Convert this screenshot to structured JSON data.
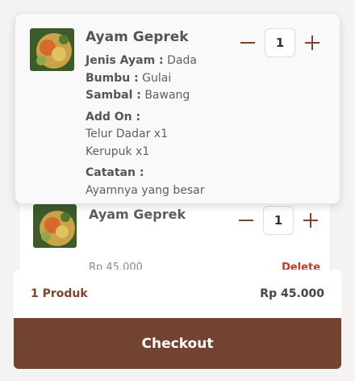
{
  "cart_item_front": {
    "name": "Ayam Geprek",
    "quantity": "1",
    "jenis_ayam_label": "Jenis Ayam :",
    "jenis_ayam_value": "Dada",
    "bumbu_label": "Bumbu :",
    "bumbu_value": "Gulai",
    "sambal_label": "Sambal :",
    "sambal_value": "Bawang",
    "addon_label": "Add On :",
    "addons": [
      "Telur Dadar x1",
      "Kerupuk x1"
    ],
    "catatan_label": "Catatan :",
    "catatan_value": "Ayamnya yang besar"
  },
  "cart_item_back": {
    "name": "Ayam Geprek",
    "quantity": "1",
    "price": "Rp 45.000",
    "delete_label": "Delete"
  },
  "summary": {
    "count": "1 Produk",
    "total": "Rp 45.000"
  },
  "checkout_label": "Checkout",
  "colors": {
    "brand": "#734332",
    "delete": "#c0392b"
  }
}
